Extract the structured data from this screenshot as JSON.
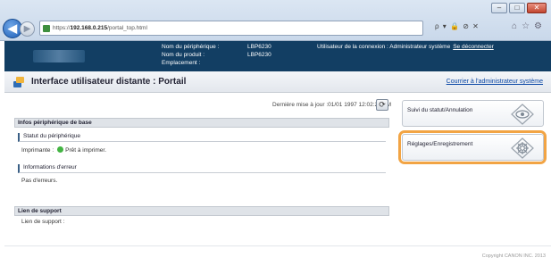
{
  "browser": {
    "url_prefix": "https://",
    "url_host": "192.168.0.215",
    "url_path": "/portal_top.html",
    "addr_tools": "ρ ▾ 🔒 ⊘ ✕",
    "right_tools": [
      "⌂",
      "☆",
      "⚙"
    ],
    "window_buttons": [
      "–",
      "□",
      "✕"
    ]
  },
  "header": {
    "device_name_label": "Nom du périphérique :",
    "device_name": "LBP6230",
    "product_name_label": "Nom du produit :",
    "product_name": "LBP6230",
    "location_label": "Emplacement :",
    "location": "",
    "user_text": "Utilisateur de la connexion : Administrateur système",
    "logout_link": "Se déconnecter"
  },
  "titlebar": {
    "title": "Interface utilisateur distante : Portail",
    "admin_link": "Courrier à l'administrateur système"
  },
  "main": {
    "last_update_label": "Dernière mise à jour :01/01 1997 12:02:28 AM",
    "basic_info": {
      "heading": "Infos périphérique de base",
      "status_heading": "Statut du périphérique",
      "printer_label": "Imprimante :",
      "printer_status": "Prêt à imprimer.",
      "error_heading": "Informations d'erreur",
      "error_text": "Pas d'erreurs."
    },
    "support": {
      "heading": "Lien de support",
      "label": "Lien de support :"
    }
  },
  "side": {
    "status_button": "Suivi du statut/Annulation",
    "settings_button": "Réglages/Enregistrement"
  },
  "footer": {
    "copyright": "Copyright CANON INC. 2013"
  },
  "colors": {
    "header_bg": "#123e63",
    "highlight": "#f2a444",
    "status_ok": "#43b443",
    "link": "#0a47a5"
  }
}
